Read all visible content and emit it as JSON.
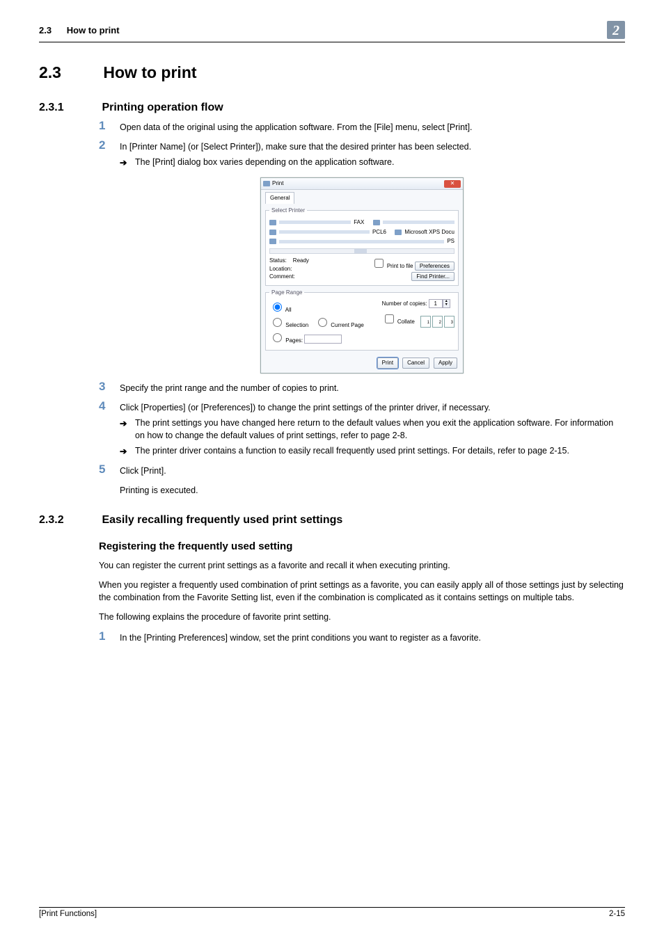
{
  "header": {
    "section_no": "2.3",
    "section_title_small": "How to print",
    "chapter_badge": "2"
  },
  "main": {
    "h1_no": "2.3",
    "h1_title": "How to print",
    "h2a_no": "2.3.1",
    "h2a_title": "Printing operation flow",
    "steps_a": [
      "Open data of the original using the application software. From the [File] menu, select [Print].",
      "In [Printer Name] (or [Select Printer]), make sure that the desired printer has been selected."
    ],
    "arrow_a1": "The [Print] dialog box varies depending on the application software.",
    "step3": "Specify the print range and the number of copies to print.",
    "step4": "Click [Properties] (or [Preferences]) to change the print settings of the printer driver, if necessary.",
    "arrow_b1": "The print settings you have changed here return to the default values when you exit the application software. For information on how to change the default values of print settings, refer to page 2-8.",
    "arrow_b2": "The printer driver contains a function to easily recall frequently used print settings. For details, refer to page 2-15.",
    "step5": "Click [Print].",
    "step5_after": "Printing is executed.",
    "h2b_no": "2.3.2",
    "h2b_title": "Easily recalling frequently used print settings",
    "h3_title": "Registering the frequently used setting",
    "para1": "You can register the current print settings as a favorite and recall it when executing printing.",
    "para2": "When you register a frequently used combination of print settings as a favorite, you can easily apply all of those settings just by selecting the combination from the Favorite Setting list, even if the combination is complicated as it contains settings on multiple tabs.",
    "para3": "The following explains the procedure of favorite print setting.",
    "step_c1": "In the [Printing Preferences] window, set the print conditions you want to register as a favorite."
  },
  "print_dialog": {
    "title": "Print",
    "tab": "General",
    "select_printer_legend": "Select Printer",
    "printer_labels": {
      "fax": "FAX",
      "pcl6": "PCL6",
      "ps": "PS",
      "xps": "Microsoft XPS Docu"
    },
    "status_label": "Status:",
    "status_value": "Ready",
    "location_label": "Location:",
    "comment_label": "Comment:",
    "print_to_file": "Print to file",
    "preferences_btn": "Preferences",
    "find_printer_btn": "Find Printer...",
    "page_range_legend": "Page Range",
    "range_all": "All",
    "range_selection": "Selection",
    "range_current": "Current Page",
    "range_pages": "Pages:",
    "copies_label": "Number of copies:",
    "copies_value": "1",
    "collate_label": "Collate",
    "btn_print": "Print",
    "btn_cancel": "Cancel",
    "btn_apply": "Apply"
  },
  "footer": {
    "left": "[Print Functions]",
    "right": "2-15"
  }
}
